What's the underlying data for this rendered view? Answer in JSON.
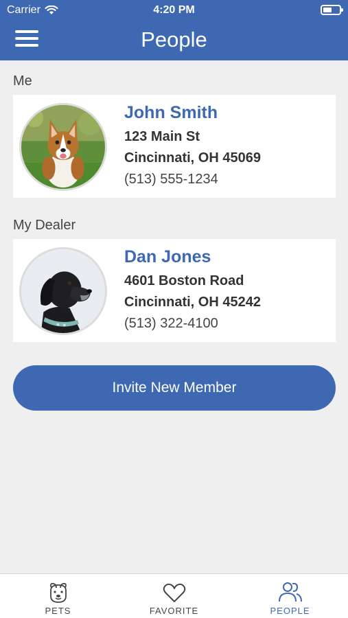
{
  "status_bar": {
    "carrier": "Carrier",
    "time": "4:20 PM",
    "icons": [
      "wifi-icon",
      "battery-icon"
    ]
  },
  "header": {
    "title": "People",
    "menu_icon": "hamburger-menu-icon"
  },
  "colors": {
    "primary": "#3e68b2",
    "background": "#efefef",
    "card": "#ffffff",
    "text_dark": "#333333"
  },
  "sections": {
    "me": {
      "label": "Me",
      "name": "John Smith",
      "address_line1": "123 Main St",
      "address_line2": "Cincinnati, OH 45069",
      "phone": "(513) 555-1234",
      "avatar": "corgi-photo"
    },
    "dealer": {
      "label": "My Dealer",
      "name": "Dan Jones",
      "address_line1": "4601 Boston Road",
      "address_line2": "Cincinnati, OH 45242",
      "phone": "(513) 322-4100",
      "avatar": "black-lab-photo"
    }
  },
  "invite_button": {
    "label": "Invite New Member"
  },
  "tabbar": {
    "tabs": [
      {
        "label": "PETS",
        "icon": "dog-face-icon",
        "active": false
      },
      {
        "label": "FAVORITE",
        "icon": "heart-icon",
        "active": false
      },
      {
        "label": "PEOPLE",
        "icon": "people-icon",
        "active": true
      }
    ]
  }
}
